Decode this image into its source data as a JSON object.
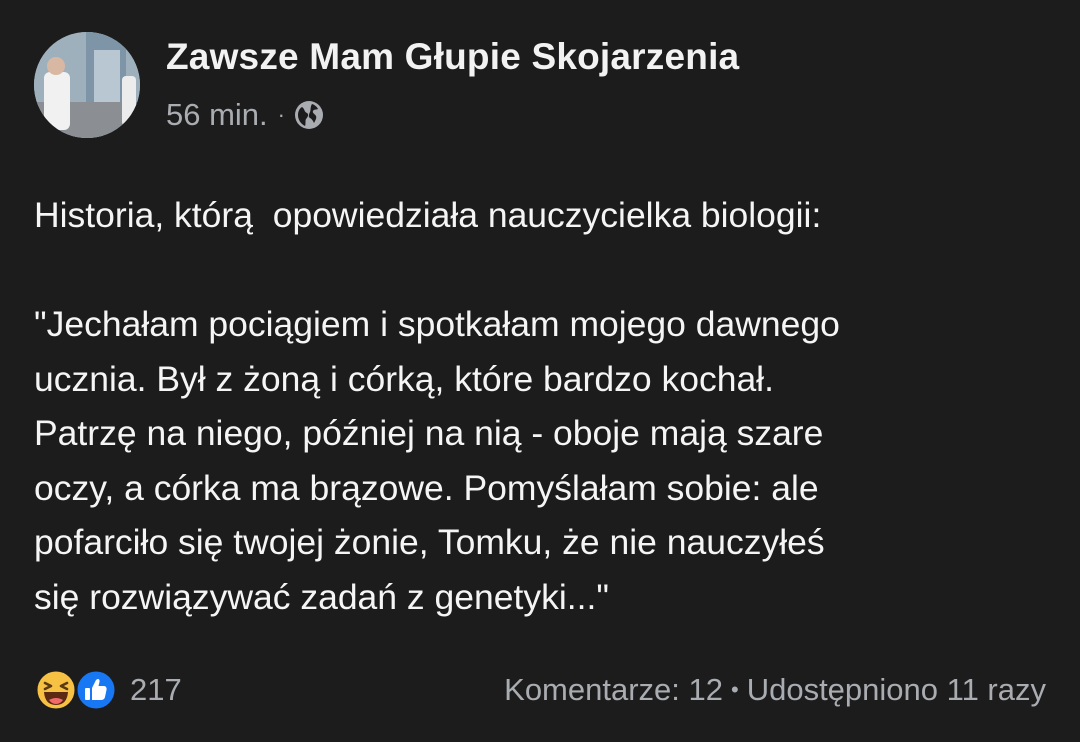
{
  "post": {
    "author": "Zawsze Mam Głupie Skojarzenia",
    "time": "56 min.",
    "time_separator": "·",
    "audience_icon": "globe-icon",
    "paragraphs": [
      "Historia, którą  opowiedziała nauczycielka biologii:",
      "",
      "\"Jechałam pociągiem i spotkałam mojego dawnego",
      "ucznia. Był z żoną i córką, które bardzo kochał.",
      "Patrzę na niego, później na nią - oboje mają szare",
      "oczy, a córka ma brązowe. Pomyślałam sobie: ale",
      "pofarciło się twojej żonie, Tomku, że nie nauczyłeś",
      "się rozwiązywać zadań z genetyki...\""
    ]
  },
  "footer": {
    "reaction_icons": [
      "haha-emoji-icon",
      "like-thumb-icon"
    ],
    "reaction_count": "217",
    "comments": "Komentarze: 12",
    "separator": "•",
    "shares": "Udostępniono 11 razy"
  },
  "colors": {
    "background": "#1c1c1d",
    "text": "#f5f5f5",
    "secondary_text": "#a9acb0",
    "like_blue": "#1877f2",
    "haha_yellow": "#f7c244"
  }
}
